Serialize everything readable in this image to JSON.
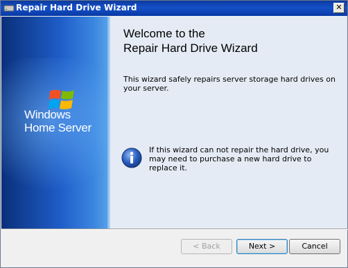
{
  "window": {
    "title": "Repair Hard Drive Wizard",
    "close_label": "✕"
  },
  "sidebar": {
    "brand_line1": "Windows",
    "brand_line2": "Home Server"
  },
  "content": {
    "heading_line1": "Welcome to the",
    "heading_line2": "Repair Hard Drive Wizard",
    "intro": "This wizard safely repairs server storage hard drives on your server.",
    "info_text": "If this wizard can not repair the hard drive, you may need to purchase a new hard drive to replace it.",
    "info_icon": "info-icon"
  },
  "buttons": {
    "back": "< Back",
    "next": "Next >",
    "cancel": "Cancel"
  },
  "colors": {
    "title_bar": "#0b3a9e",
    "sidebar": "#1f5ec9",
    "content_bg": "#e4ebf4"
  }
}
